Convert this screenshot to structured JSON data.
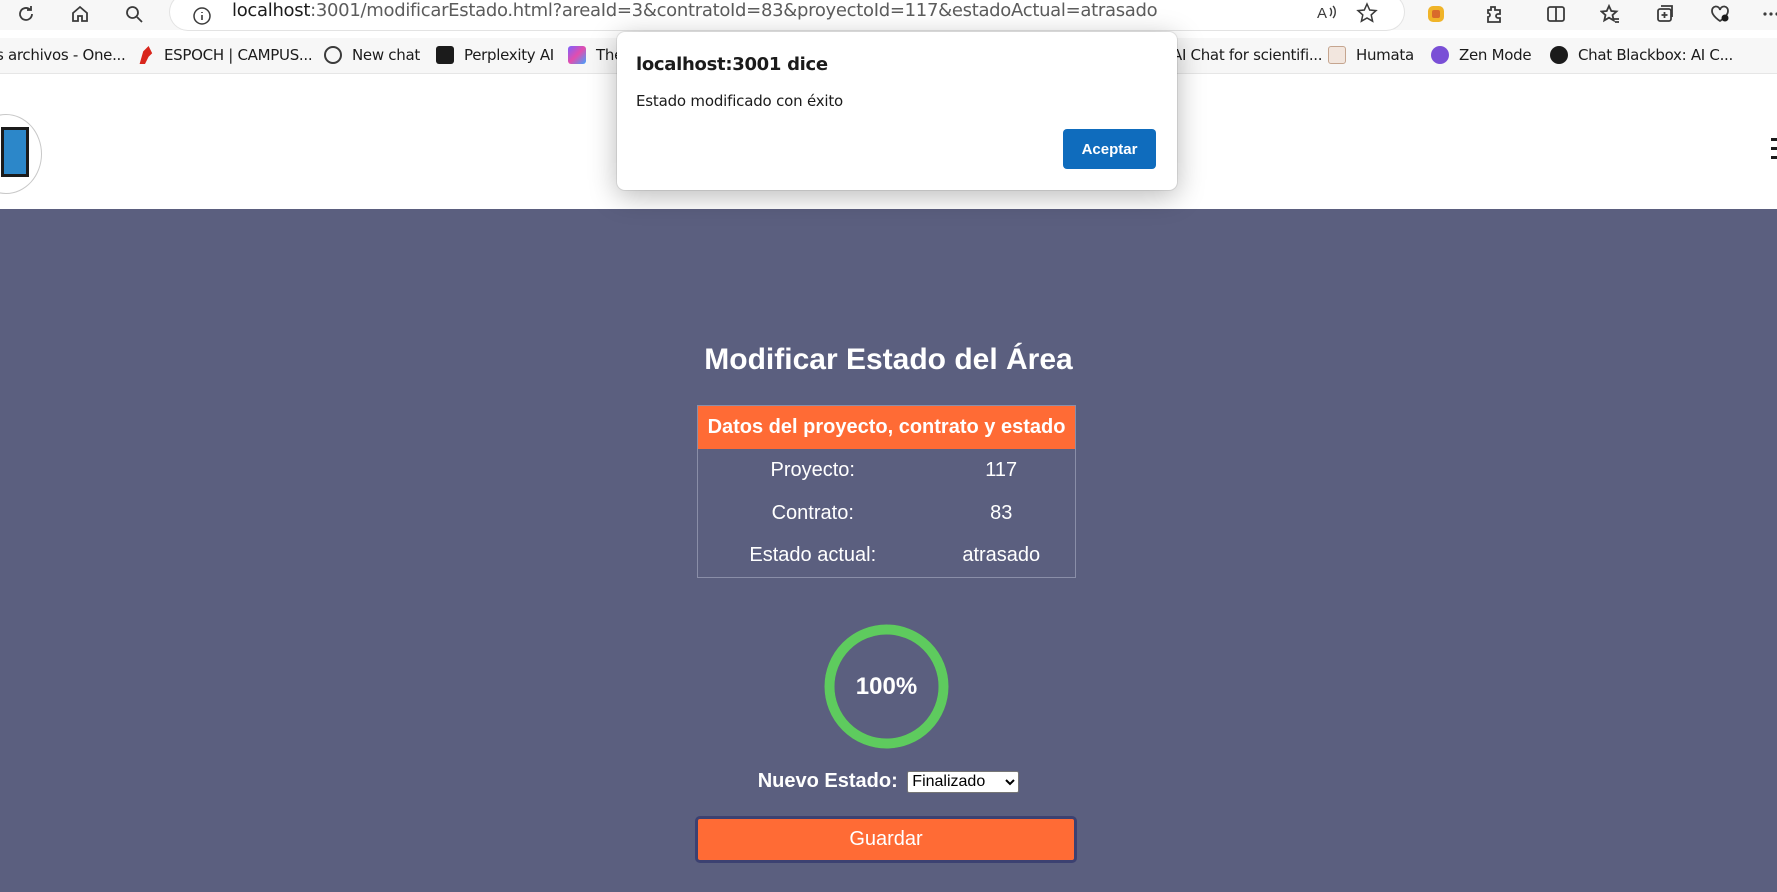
{
  "browser": {
    "url_host": "localhost",
    "url_rest": ":3001/modificarEstado.html?areaId=3&contratoId=83&proyectoId=117&estadoActual=atrasado",
    "bookmarks": [
      {
        "label": "s archivos - One...",
        "icon": "onedrive-icon",
        "color": "#ffffff"
      },
      {
        "label": "ESPOCH | CAMPUS...",
        "icon": "espoch-icon",
        "color": "#d9261c"
      },
      {
        "label": "New chat",
        "icon": "openai-icon",
        "color": "#ffffff"
      },
      {
        "label": "Perplexity AI",
        "icon": "perplexity-icon",
        "color": "#1b1b1b"
      },
      {
        "label": "The",
        "icon": "app-icon",
        "color": "#7b61ff"
      },
      {
        "label": "AI Chat for scientifi...",
        "icon": "scite-icon",
        "color": "#f7f7f7"
      },
      {
        "label": "Humata",
        "icon": "humata-icon",
        "color": "#f2e6de"
      },
      {
        "label": "Zen Mode",
        "icon": "zen-icon",
        "color": "#7a4fd6"
      },
      {
        "label": "Chat Blackbox: AI C...",
        "icon": "blackbox-icon",
        "color": "#1b1b1b"
      }
    ]
  },
  "page": {
    "title": "Modificar Estado del Área",
    "table": {
      "header": "Datos del proyecto, contrato y estado",
      "rows": [
        {
          "label": "Proyecto:",
          "value": "117"
        },
        {
          "label": "Contrato:",
          "value": "83"
        },
        {
          "label": "Estado actual:",
          "value": "atrasado"
        }
      ]
    },
    "progress": {
      "percent": 100,
      "label": "100%",
      "color": "#5ecb5e"
    },
    "new_state_label": "Nuevo Estado:",
    "new_state_selected": "Finalizado",
    "save_label": "Guardar"
  },
  "dialog": {
    "title": "localhost:3001 dice",
    "message": "Estado modificado con éxito",
    "button": "Aceptar"
  },
  "colors": {
    "accent": "#ff6b35",
    "background": "#5b5f7f",
    "dialog_button": "#0f6cbd"
  }
}
